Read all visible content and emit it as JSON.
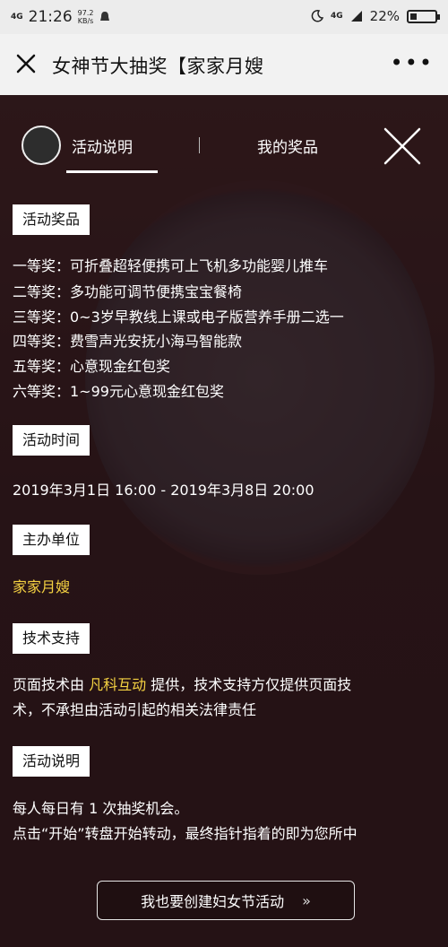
{
  "status_bar": {
    "network": "4G",
    "time": "21:26",
    "speed_value": "97.2",
    "speed_unit": "KB/s",
    "network_right": "4G",
    "battery": "22%"
  },
  "navbar": {
    "title": "女神节大抽奖【家家月嫂",
    "close_icon": "close-icon",
    "more_label": "•••"
  },
  "tabs": [
    {
      "label": "活动说明",
      "active": true
    },
    {
      "label": "我的奖品",
      "active": false
    }
  ],
  "sections": {
    "prizes": {
      "heading": "活动奖品",
      "items": [
        "一等奖：可折叠超轻便携可上飞机多功能婴儿推车",
        "二等奖：多功能可调节便携宝宝餐椅",
        "三等奖：0~3岁早教线上课或电子版营养手册二选一",
        "四等奖：费雪声光安抚小海马智能款",
        "五等奖：心意现金红包奖",
        "六等奖：1~99元心意现金红包奖"
      ]
    },
    "time": {
      "heading": "活动时间",
      "value": "2019年3月1日 16:00 - 2019年3月8日 20:00"
    },
    "organizer": {
      "heading": "主办单位",
      "value": "家家月嫂"
    },
    "tech": {
      "heading": "技术支持",
      "prefix": "页面技术由 ",
      "company": "凡科互动",
      "suffix": " 提供，技术支持方仅提供页面技",
      "line2": "术，不承担由活动引起的相关法律责任"
    },
    "rules": {
      "heading": "活动说明",
      "line1": "每人每日有 1 次抽奖机会。",
      "line2": "点击“开始”转盘开始转动，最终指针指着的即为您所中"
    }
  },
  "bottom_button": {
    "label": "我也要创建妇女节活动",
    "arrow": "»"
  },
  "colors": {
    "accent_yellow": "#f5d242",
    "overlay": "#3a1f23"
  }
}
